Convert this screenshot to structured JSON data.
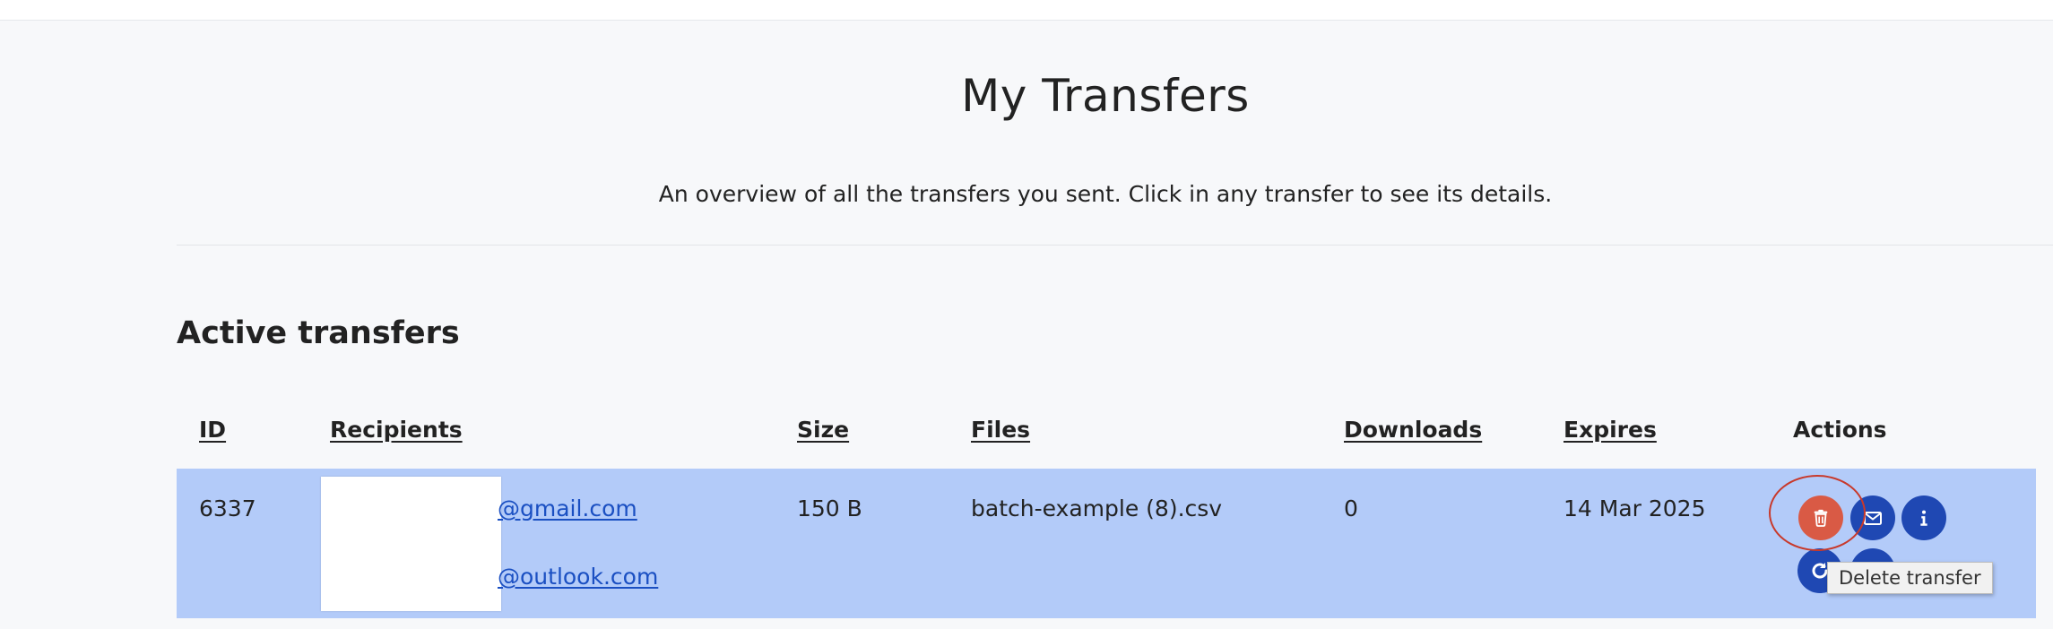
{
  "header": {
    "title": "My Transfers",
    "subtitle": "An overview of all the transfers you sent. Click in any transfer to see its details."
  },
  "section": {
    "title": "Active transfers"
  },
  "table": {
    "columns": {
      "id": "ID",
      "recipients": "Recipients",
      "size": "Size",
      "files": "Files",
      "downloads": "Downloads",
      "expires": "Expires",
      "actions": "Actions"
    },
    "rows": [
      {
        "id": "6337",
        "recipients": [
          "@gmail.com",
          "@outlook.com"
        ],
        "size": "150 B",
        "files": "batch-example (8).csv",
        "downloads": "0",
        "expires": "14 Mar 2025"
      }
    ]
  },
  "actions": {
    "icons": [
      "trash-icon",
      "envelope-icon",
      "info-icon",
      "refresh-icon",
      "copy-icon"
    ]
  },
  "tooltip": {
    "text": "Delete transfer"
  },
  "colors": {
    "row_highlight": "#b3cbf9",
    "delete_button": "#d95a45",
    "action_button": "#1f48b3",
    "link": "#1a4fc2",
    "annotation_ring": "#c8392b"
  }
}
